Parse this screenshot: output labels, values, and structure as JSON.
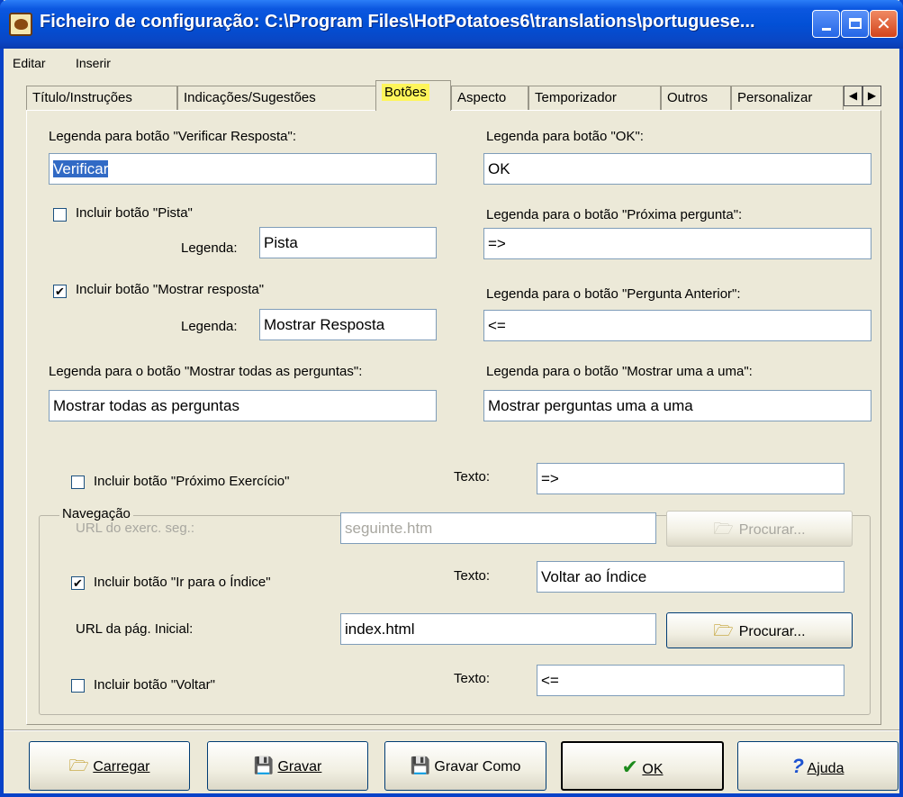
{
  "window": {
    "title": "Ficheiro de configuração: C:\\Program Files\\HotPotatoes6\\translations\\portuguese..."
  },
  "menu": [
    "Editar",
    "Inserir"
  ],
  "tabs": [
    "Título/Instruções",
    "Indicações/Sugestões",
    "Botões",
    "Aspecto",
    "Temporizador",
    "Outros",
    "Personalizar"
  ],
  "active_tab": "Botões",
  "tab_scroll": {
    "left": "◀",
    "right": "▶"
  },
  "left_col": {
    "verify_label": "Legenda para botão \"Verificar Resposta\":",
    "verify_value": "Verificar",
    "hint_check_label": "Incluir botão \"Pista\"",
    "hint_checked": false,
    "hint_caption_label": "Legenda:",
    "hint_caption_value": "Pista",
    "show_answer_check_label": "Incluir botão \"Mostrar resposta\"",
    "show_answer_checked": true,
    "show_answer_caption_label": "Legenda:",
    "show_answer_caption_value": "Mostrar Resposta",
    "show_all_label": "Legenda para o botão \"Mostrar todas as perguntas\":",
    "show_all_value": "Mostrar todas as perguntas"
  },
  "right_col": {
    "ok_label": "Legenda para botão \"OK\":",
    "ok_value": "OK",
    "next_q_label": "Legenda para o botão \"Próxima pergunta\":",
    "next_q_value": "=>",
    "prev_q_label": "Legenda para o botão \"Pergunta Anterior\":",
    "prev_q_value": "<=",
    "one_by_one_label": "Legenda para o botão \"Mostrar uma a uma\":",
    "one_by_one_value": "Mostrar perguntas uma a uma"
  },
  "navigation": {
    "title": "Navegação",
    "next_ex_check_label": "Incluir botão \"Próximo Exercício\"",
    "next_ex_checked": false,
    "next_ex_text_label": "Texto:",
    "next_ex_text_value": "=>",
    "next_url_label": "URL do exerc. seg.:",
    "next_url_value": "seguinte.htm",
    "browse_label": "Procurar...",
    "index_check_label": "Incluir botão \"Ir para o Índice\"",
    "index_checked": true,
    "index_text_label": "Texto:",
    "index_text_value": "Voltar ao Índice",
    "home_url_label": "URL da pág. Inicial:",
    "home_url_value": "index.html",
    "back_check_label": "Incluir botão \"Voltar\"",
    "back_checked": false,
    "back_text_label": "Texto:",
    "back_text_value": "<="
  },
  "buttons": {
    "load": "Carregar",
    "save": "Gravar",
    "save_as": "Gravar Como",
    "ok": "OK",
    "help": "Ajuda"
  }
}
